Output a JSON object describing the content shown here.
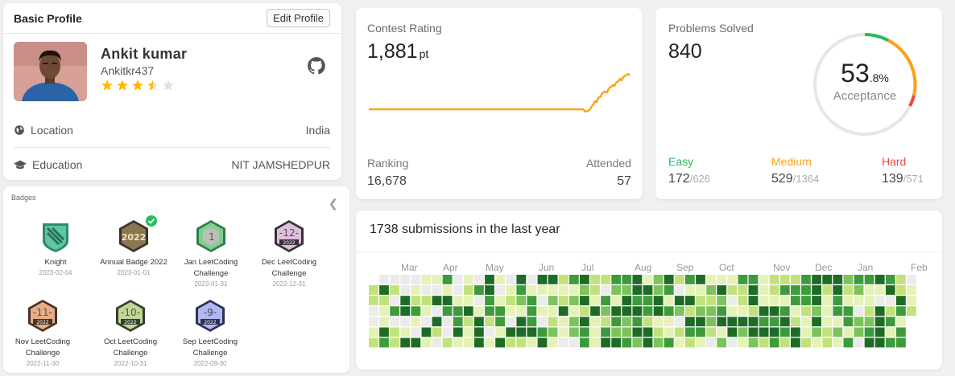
{
  "profile": {
    "title": "Basic Profile",
    "edit_label": "Edit Profile",
    "name": "Ankit kumar",
    "username": "Ankitkr437",
    "rating_stars": 3.5,
    "location_label": "Location",
    "location_value": "India",
    "education_label": "Education",
    "education_value": "NIT JAMSHEDPUR"
  },
  "badges": {
    "title": "Badges",
    "items": [
      {
        "name": "Knight",
        "date": "2023-02-04",
        "icon": "knight-badge-icon",
        "color": "#3daa88"
      },
      {
        "name": "Annual Badge 2022",
        "date": "2023-01-01",
        "icon": "annual-badge-icon",
        "color": "#7a6a44"
      },
      {
        "name": "Jan LeetCoding Challenge",
        "date": "2023-01-31",
        "icon": "jan-challenge-badge-icon",
        "color": "#4aa36b"
      },
      {
        "name": "Dec LeetCoding Challenge",
        "date": "2022-12-31",
        "icon": "dec-challenge-badge-icon",
        "color": "#c9a8c9"
      },
      {
        "name": "Nov LeetCoding Challenge",
        "date": "2022-11-30",
        "icon": "nov-challenge-badge-icon",
        "color": "#d9a17a"
      },
      {
        "name": "Oct LeetCoding Challenge",
        "date": "2022-10-31",
        "icon": "oct-challenge-badge-icon",
        "color": "#b6c987"
      },
      {
        "name": "Sep LeetCoding Challenge",
        "date": "2022-09-30",
        "icon": "sep-challenge-badge-icon",
        "color": "#a6b0e6"
      }
    ]
  },
  "contest": {
    "label": "Contest Rating",
    "rating": "1,881",
    "unit": "pt",
    "ranking_label": "Ranking",
    "ranking_value": "16,678",
    "attended_label": "Attended",
    "attended_value": "57",
    "line_color": "#ffa116"
  },
  "problems": {
    "label": "Problems Solved",
    "solved": "840",
    "acceptance_int": "53",
    "acceptance_dec": ".8%",
    "acceptance_label": "Acceptance",
    "easy": {
      "label": "Easy",
      "solved": "172",
      "total": "/626",
      "color": "#2cbb5d"
    },
    "medium": {
      "label": "Medium",
      "solved": "529",
      "total": "/1364",
      "color": "#ffa116"
    },
    "hard": {
      "label": "Hard",
      "solved": "139",
      "total": "/571",
      "color": "#ef4743"
    }
  },
  "heatmap": {
    "title": "1738 submissions in the last year",
    "months": [
      "Mar",
      "Apr",
      "May",
      "Jun",
      "Jul",
      "Aug",
      "Sep",
      "Oct",
      "Nov",
      "Dec",
      "Jan",
      "Feb"
    ],
    "levels_palette": [
      "#ebebeb",
      "#e4f2b6",
      "#c1e27a",
      "#7bc35a",
      "#3d9b3b",
      "#1e6b25"
    ]
  }
}
